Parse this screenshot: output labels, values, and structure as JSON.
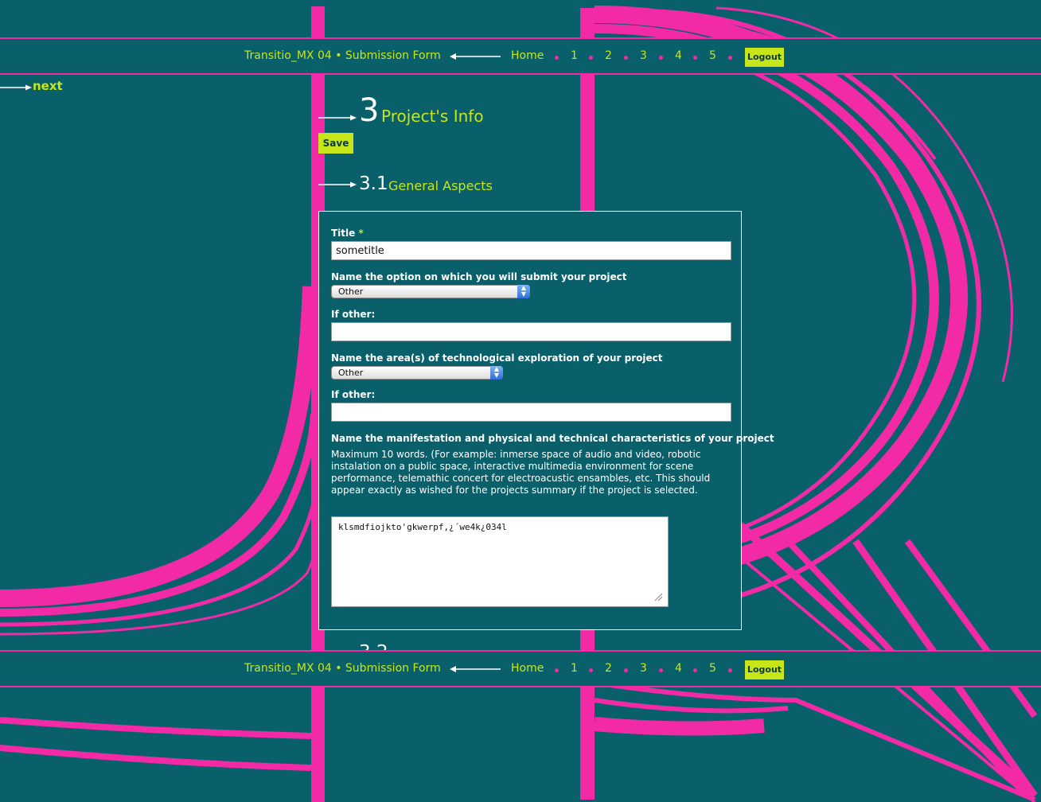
{
  "header": {
    "site_title": "Transitio_MX 04 • Submission Form",
    "nav": [
      {
        "label": "Home"
      },
      {
        "label": "1"
      },
      {
        "label": "2"
      },
      {
        "label": "3"
      },
      {
        "label": "4"
      },
      {
        "label": "5"
      }
    ],
    "logout_label": "Logout"
  },
  "next_label": "next",
  "section": {
    "number": "3",
    "title": "Project's Info",
    "save_label": "Save"
  },
  "subsection": {
    "number": "3.1",
    "title": "General Aspects",
    "next_number_peek": "3.2"
  },
  "form": {
    "title_label": "Title",
    "required_marker": "*",
    "title_value": "sometitle",
    "option_label": "Name the option on which you will submit your project",
    "option_selected": "Other",
    "if_other_label_1": "If other:",
    "if_other_value_1": "",
    "area_label": "Name the area(s) of technological exploration of your project",
    "area_selected": "Other",
    "if_other_label_2": "If other:",
    "if_other_value_2": "",
    "manifestation_label": "Name the manifestation and physical and technical characteristics of your project",
    "manifestation_help": "Maximum 10 words. (For example: inmerse space of audio and video, robotic instalation on a public space, interactive multimedia environment for scene performance, telemathic concert for electroacustic ensambles, etc. This should appear exactly as wished for the projects summary if the project is selected.",
    "manifestation_value": "klsmdfiojkto'gkwerpf,¿´we4k¿034l"
  },
  "colors": {
    "background": "#09606a",
    "accent_pink": "#f22aa6",
    "accent_lime": "#c6e61a",
    "text_white": "#ffffff"
  }
}
